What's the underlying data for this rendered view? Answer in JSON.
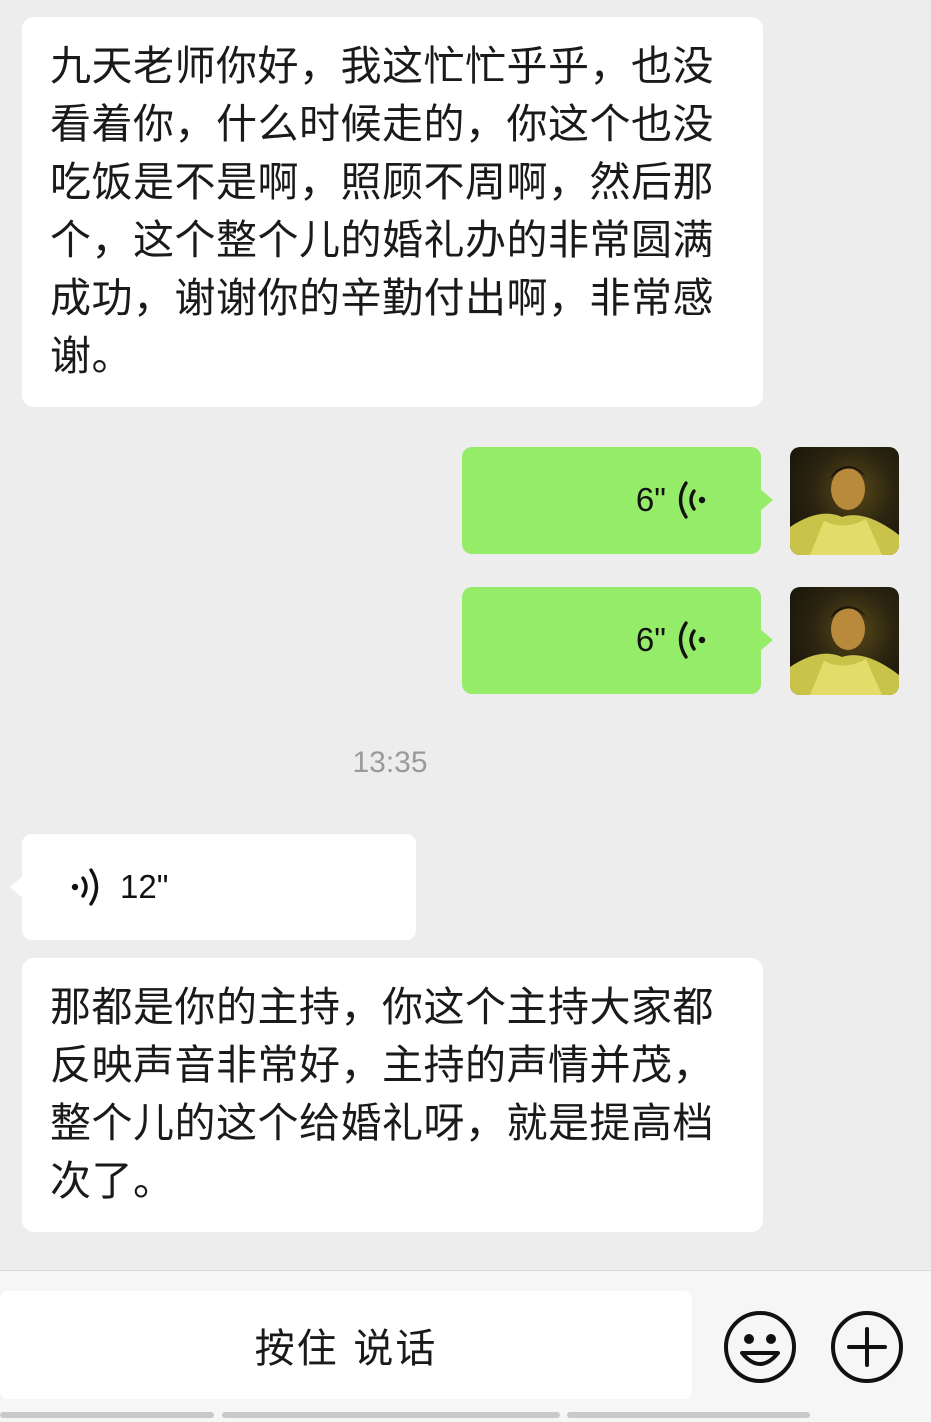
{
  "messages": {
    "incoming_text_1": "九天老师你好，我这忙忙乎乎，也没看着你，什么时候走的，你这个也没吃饭是不是啊，照顾不周啊，然后那个，这个整个儿的婚礼办的非常圆满成功，谢谢你的辛勤付出啊，非常感谢。",
    "outgoing_voice_1": {
      "duration": "6\""
    },
    "outgoing_voice_2": {
      "duration": "6\""
    },
    "timestamp": "13:35",
    "incoming_voice_1": {
      "duration": "12\""
    },
    "incoming_text_2": "那都是你的主持，你这个主持大家都反映声音非常好，主持的声情并茂，整个儿的这个给婚礼呀，就是提高档次了。"
  },
  "input_bar": {
    "hold_to_talk_label": "按住 说话",
    "emoji_icon": "emoji-smile-icon",
    "plus_icon": "plus-circle-icon"
  },
  "colors": {
    "background": "#ededed",
    "outgoing_bubble": "#95ec69",
    "incoming_bubble": "#ffffff",
    "timestamp_text": "#9a9a9a"
  }
}
